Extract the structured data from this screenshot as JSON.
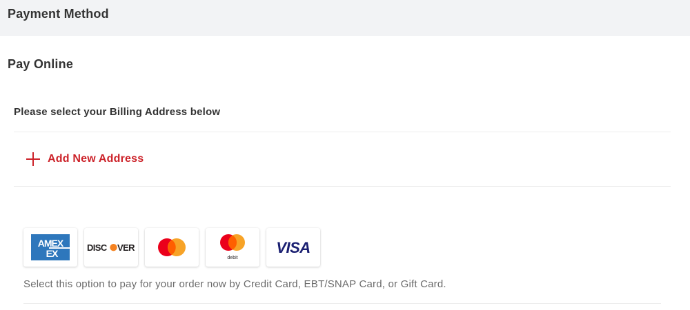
{
  "header": {
    "title": "Payment Method"
  },
  "pay_online": {
    "title": "Pay Online"
  },
  "billing": {
    "title": "Please select your Billing Address below",
    "add_address_label": "Add New Address"
  },
  "cards": [
    {
      "name": "amex-icon",
      "label": "AMEX"
    },
    {
      "name": "discover-icon",
      "label": "DISCOVER"
    },
    {
      "name": "mastercard-icon",
      "label": ""
    },
    {
      "name": "mastercard-debit-icon",
      "label": "debit"
    },
    {
      "name": "visa-icon",
      "label": "VISA"
    }
  ],
  "note": "Select this option to pay for your order now by Credit Card, EBT/SNAP Card, or Gift Card.",
  "colors": {
    "accent_red": "#cc2229",
    "amex_blue": "#2e77bc",
    "visa_blue": "#1a1f71",
    "mc_red": "#eb001b",
    "mc_orange": "#f79e1b",
    "discover_orange": "#f58220"
  }
}
